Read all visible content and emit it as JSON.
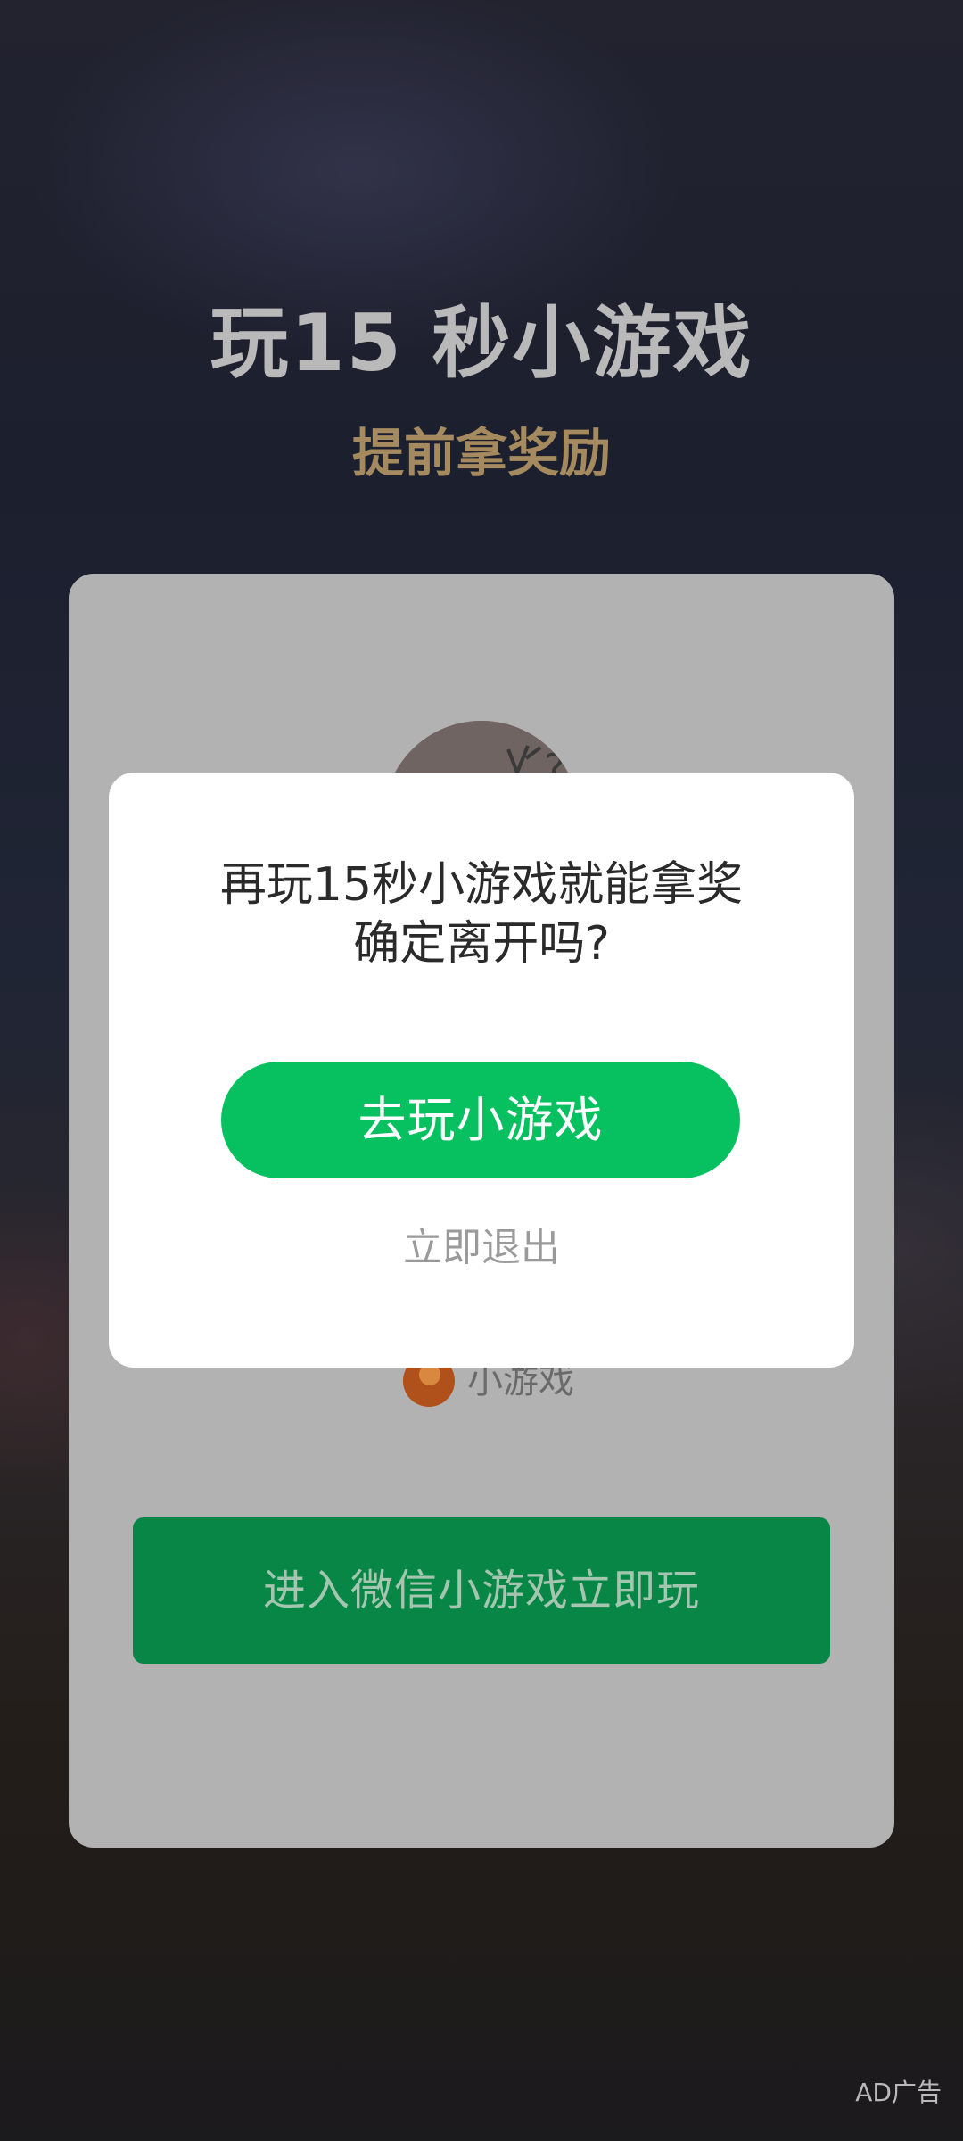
{
  "header": {
    "title": "玩15 秒小游戏",
    "subtitle": "提前拿奖励"
  },
  "card": {
    "game_icon": "game-avatar-bird",
    "brand_logo": "mini-game-logo",
    "brand_label": "小游戏",
    "enter_button_label": "进入微信小游戏立即玩"
  },
  "dialog": {
    "message_line1": "再玩15秒小游戏就能拿奖",
    "message_line2": "确定离开吗?",
    "play_button_label": "去玩小游戏",
    "exit_label": "立即退出"
  },
  "ad_label": "AD广告",
  "colors": {
    "primary_green": "#07c160",
    "dimmed_green": "#078646",
    "gold": "#a48a5e"
  }
}
